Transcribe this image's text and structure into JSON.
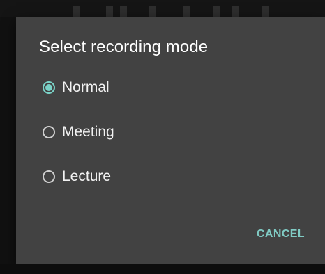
{
  "dialog": {
    "title": "Select recording mode",
    "options": [
      {
        "label": "Normal",
        "selected": true
      },
      {
        "label": "Meeting",
        "selected": false
      },
      {
        "label": "Lecture",
        "selected": false
      }
    ],
    "cancel_label": "CANCEL"
  },
  "colors": {
    "accent": "#80cbc4",
    "dialog_bg": "#424242",
    "backdrop": "#111111"
  }
}
